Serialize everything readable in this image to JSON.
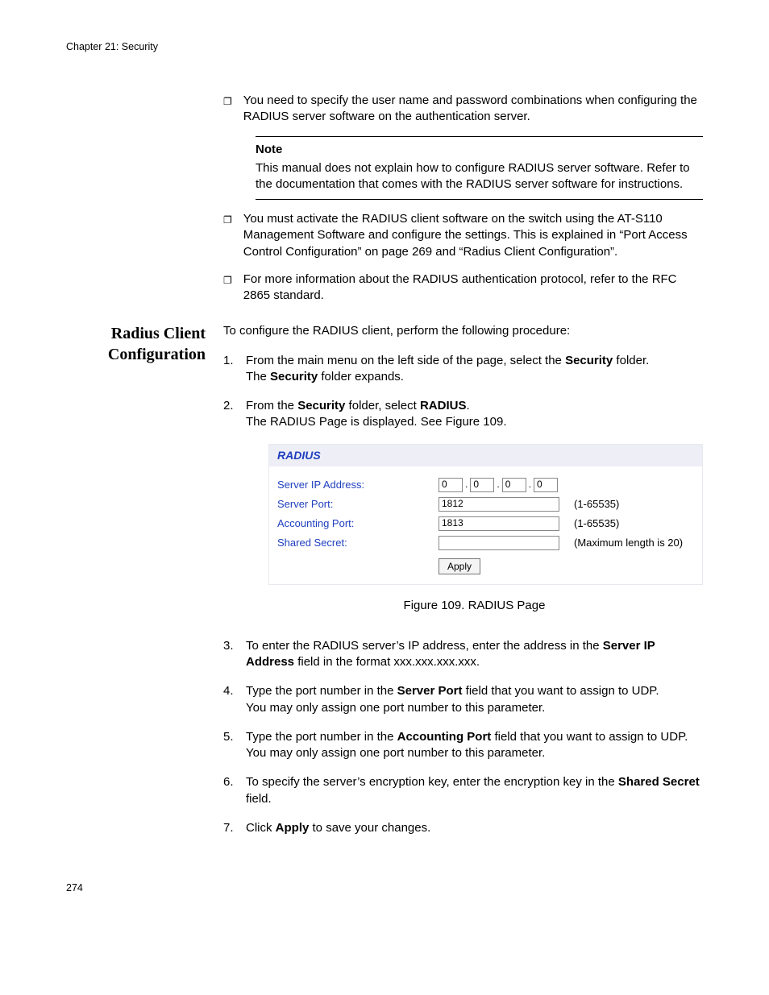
{
  "header": "Chapter 21: Security",
  "bullets_top": [
    "You need to specify the user name and password combinations when configuring the RADIUS server software on the authentication server."
  ],
  "note": {
    "title": "Note",
    "body": "This manual does not explain how to configure RADIUS server software. Refer to the documentation that comes with the RADIUS server software for instructions."
  },
  "bullets_bottom": [
    "You must activate the RADIUS client software on the switch using the AT-S110 Management Software and configure the settings. This is explained in “Port Access Control Configuration” on page 269 and “Radius Client Configuration”.",
    "For more information about the RADIUS authentication protocol, refer to the RFC 2865 standard."
  ],
  "section_heading_line1": "Radius Client",
  "section_heading_line2": "Configuration",
  "intro": "To configure the RADIUS client, perform the following procedure:",
  "steps": {
    "s1a": "From the main menu on the left side of the page, select the ",
    "s1b": "Security",
    "s1c": " folder.",
    "s1d": "The ",
    "s1e": "Security",
    "s1f": " folder expands.",
    "s2a": "From the ",
    "s2b": "Security",
    "s2c": " folder, select ",
    "s2d": "RADIUS",
    "s2e": ".",
    "s2f": "The RADIUS Page is displayed. See Figure 109.",
    "s3a": "To enter the RADIUS server’s IP address, enter the address in the ",
    "s3b": "Server IP Address",
    "s3c": " field in the format xxx.xxx.xxx.xxx.",
    "s4a": "Type the port number in the ",
    "s4b": "Server Port",
    "s4c": " field that you want to assign to UDP.",
    "s4d": "You may only assign one port number to this parameter.",
    "s5a": "Type the port number in the ",
    "s5b": "Accounting Port",
    "s5c": " field that you want to assign to UDP.",
    "s5d": "You may only assign one port number to this parameter.",
    "s6a": "To specify the server’s encryption key, enter the encryption key in the ",
    "s6b": "Shared Secret",
    "s6c": " field.",
    "s7a": "Click ",
    "s7b": "Apply",
    "s7c": " to save your changes."
  },
  "radius_panel": {
    "title": "RADIUS",
    "labels": {
      "ip": "Server IP Address:",
      "port": "Server Port:",
      "acct": "Accounting Port:",
      "secret": "Shared Secret:"
    },
    "values": {
      "ip1": "0",
      "ip2": "0",
      "ip3": "0",
      "ip4": "0",
      "port": "1812",
      "acct": "1813",
      "secret": ""
    },
    "hints": {
      "port": "(1-65535)",
      "acct": "(1-65535)",
      "secret": "(Maximum length is 20)"
    },
    "apply": "Apply"
  },
  "figure_caption": "Figure 109. RADIUS Page",
  "page_number": "274"
}
